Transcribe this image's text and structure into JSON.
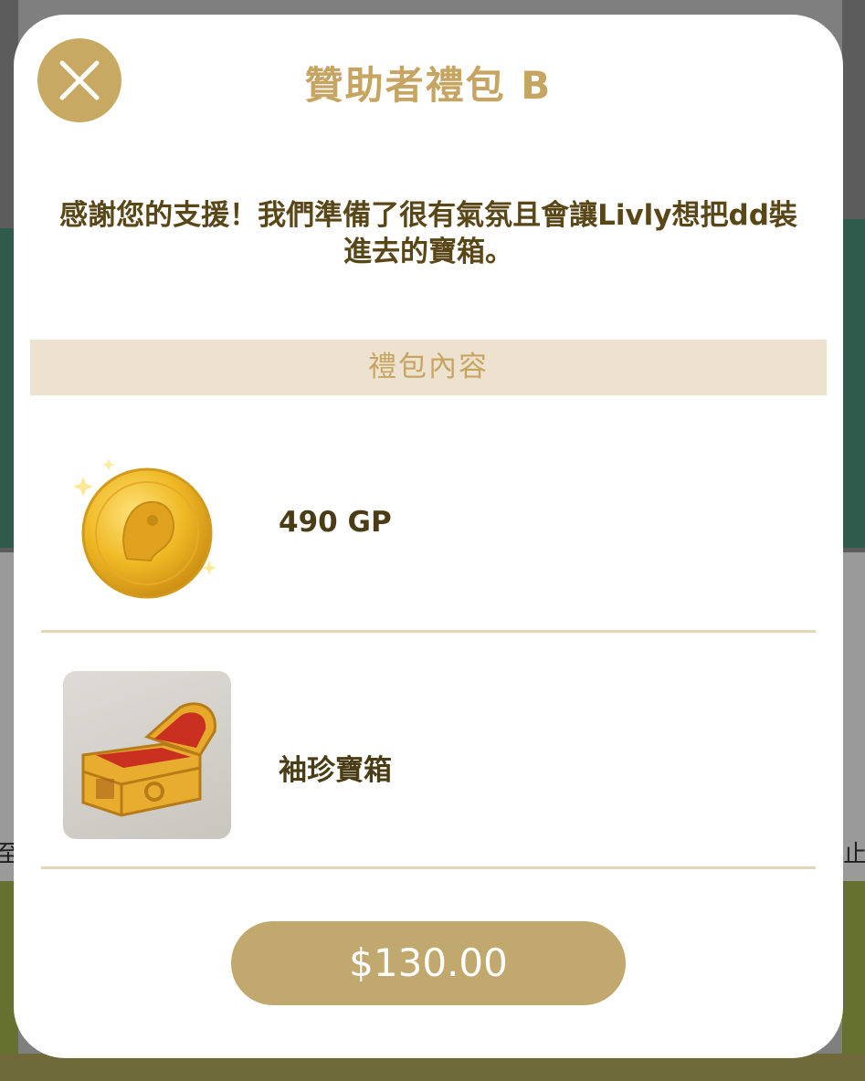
{
  "dialog": {
    "title": "贊助者禮包 B",
    "description": "感謝您的支援！我們準備了很有氣氛且會讓Livly想把dd裝進去的寶箱。",
    "section_header": "禮包內容",
    "items": [
      {
        "icon": "gold-coin-icon",
        "label": "490 GP"
      },
      {
        "icon": "treasure-chest-icon",
        "label": "袖珍寶箱"
      }
    ],
    "price": "$130.00"
  },
  "background": {
    "left_edge_char": "至",
    "right_edge_char": "止"
  },
  "colors": {
    "accent": "#c7a964",
    "title": "#c6a562",
    "text": "#5a4718",
    "section_bg": "#ede2cf",
    "button": "#c0a86e"
  }
}
